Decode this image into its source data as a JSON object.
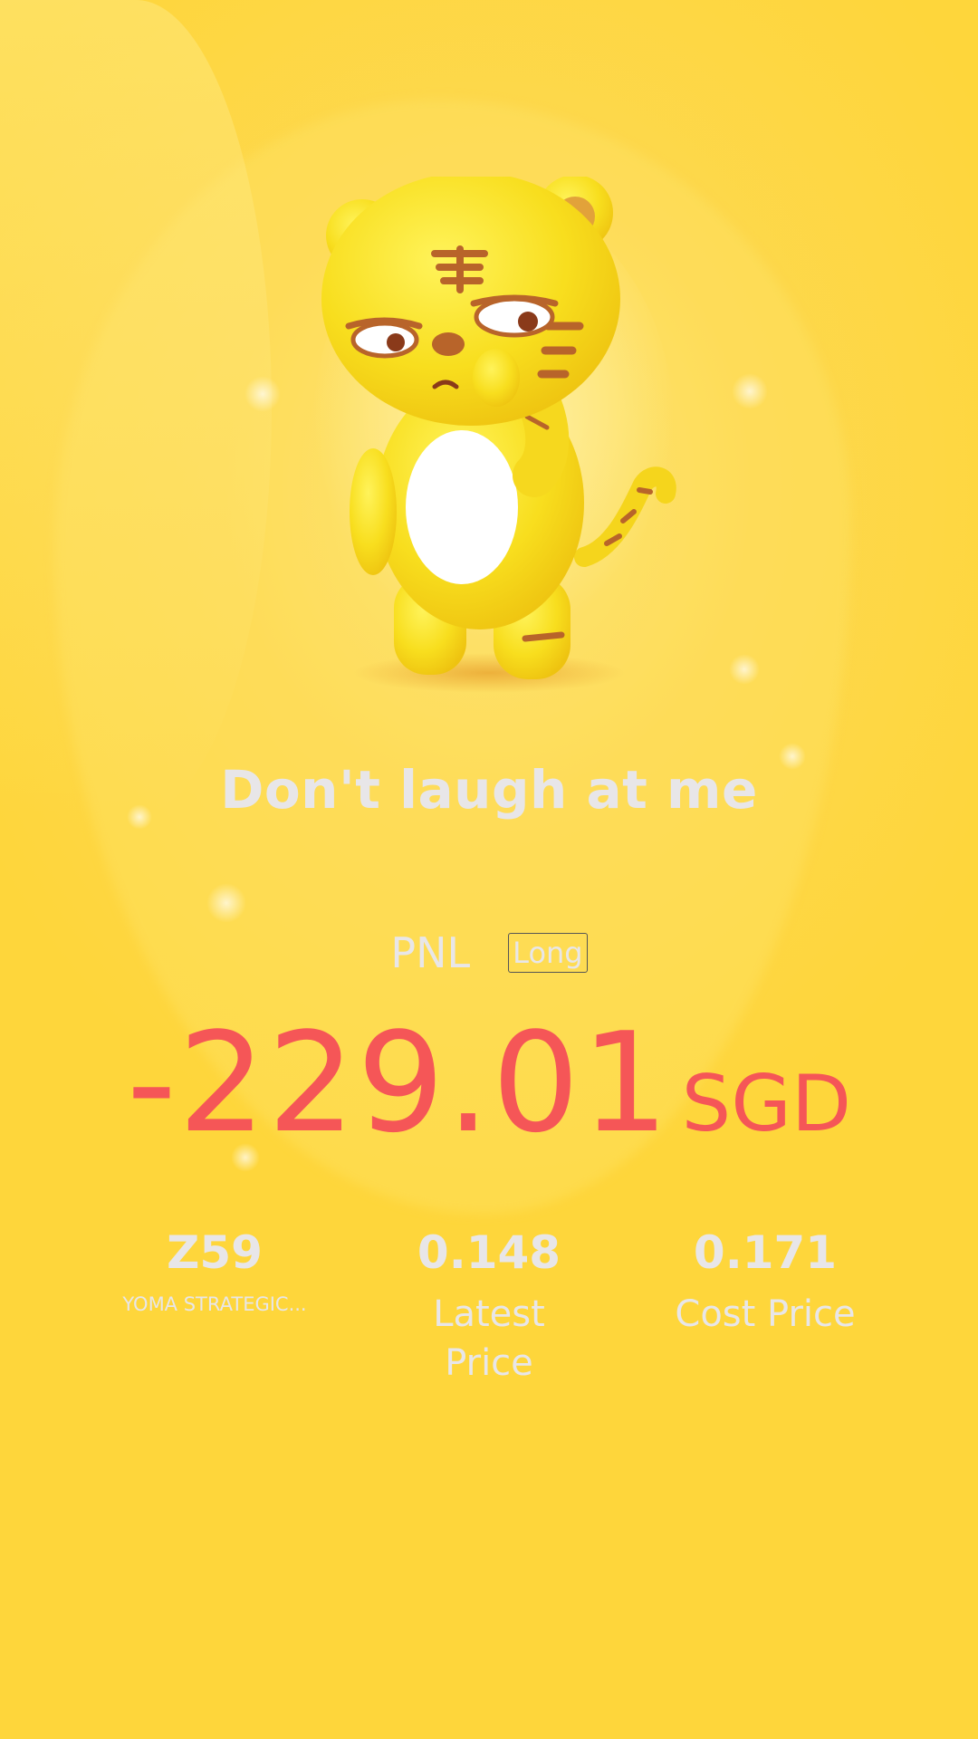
{
  "headline": "Don't laugh at me",
  "pnl": {
    "label": "PNL",
    "position_tag": "Long",
    "amount": "-229.01",
    "currency": "SGD",
    "amount_color": "#f55657"
  },
  "stats": [
    {
      "value": "Z59",
      "sub": "YOMA STRATEGIC..."
    },
    {
      "value": "0.148",
      "label": "Latest Price"
    },
    {
      "value": "0.171",
      "label": "Cost Price"
    }
  ],
  "mascot": {
    "icon": "tiger-mascot-illustration"
  },
  "theme": {
    "background": "#fed63b",
    "text_light": "#e8e6e8"
  }
}
